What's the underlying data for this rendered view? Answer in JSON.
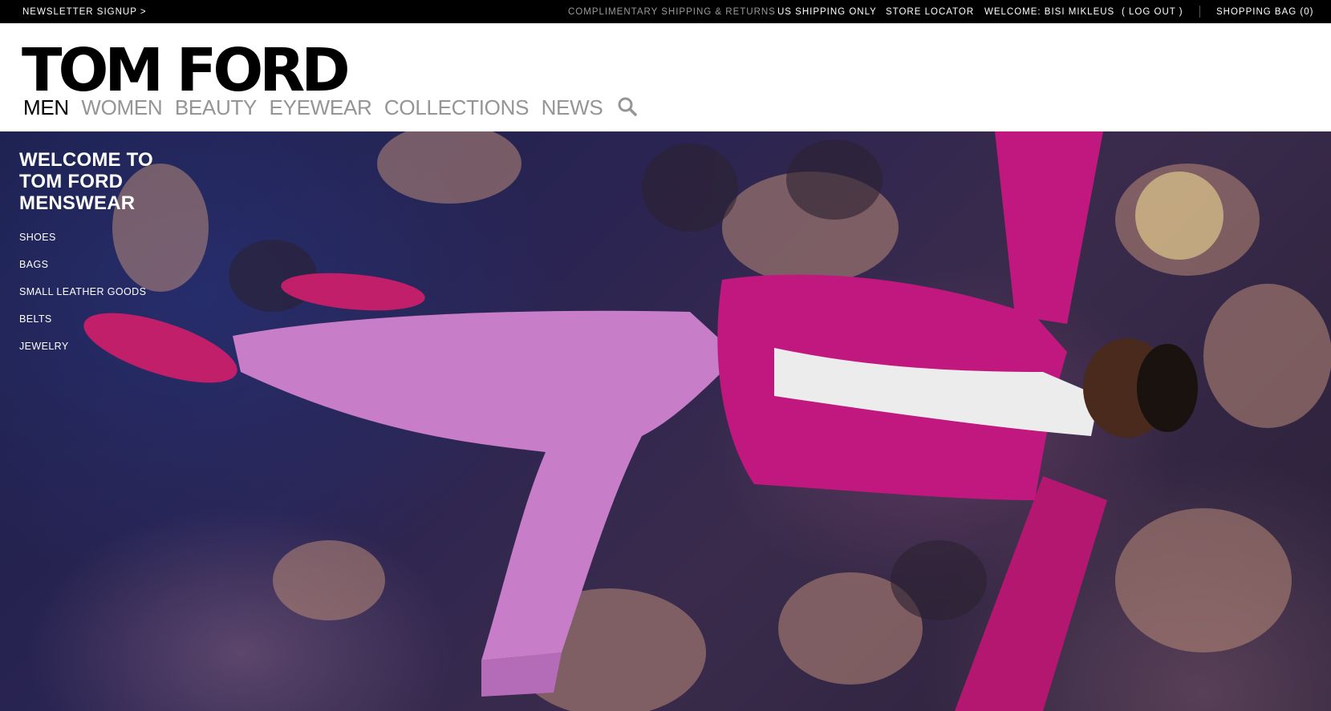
{
  "topbar": {
    "newsletter": "NEWSLETTER SIGNUP >",
    "shipping_note": "COMPLIMENTARY SHIPPING & RETURNS",
    "us_only": "US SHIPPING ONLY",
    "store_locator": "STORE LOCATOR",
    "welcome": "WELCOME: BISI MIKLEUS",
    "logout": "( LOG OUT )",
    "shopping_bag": "SHOPPING BAG (0)"
  },
  "header": {
    "logo": "TOM FORD",
    "nav": [
      {
        "label": "MEN",
        "active": true
      },
      {
        "label": "WOMEN"
      },
      {
        "label": "BEAUTY"
      },
      {
        "label": "EYEWEAR"
      },
      {
        "label": "COLLECTIONS"
      },
      {
        "label": "NEWS"
      }
    ],
    "search_icon": "search-icon"
  },
  "hero": {
    "title_lines": [
      "WELCOME TO",
      "TOM FORD",
      "MENSWEAR"
    ],
    "categories": [
      "SHOES",
      "BAGS",
      "SMALL LEATHER GOODS",
      "BELTS",
      "JEWELRY"
    ]
  },
  "colors": {
    "topbar_bg": "#000000",
    "nav_active": "#000000",
    "nav_inactive": "#959595",
    "suit_magenta": "#c0187e"
  }
}
